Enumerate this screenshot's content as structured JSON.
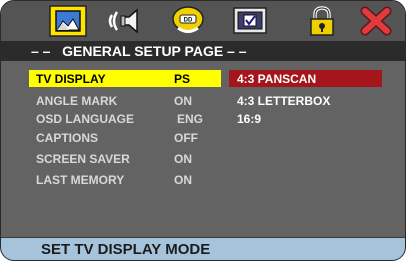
{
  "header": {
    "icons": [
      {
        "name": "general-setup-icon"
      },
      {
        "name": "audio-setup-icon"
      },
      {
        "name": "dolby-disc-icon"
      },
      {
        "name": "preference-checkbox-icon"
      },
      {
        "name": "password-lock-icon"
      },
      {
        "name": "exit-icon"
      }
    ],
    "title": "– –   GENERAL SETUP PAGE – –"
  },
  "menu": {
    "items": [
      {
        "label": "TV DISPLAY",
        "value": "PS"
      },
      {
        "label": "ANGLE MARK",
        "value": "ON"
      },
      {
        "label": "OSD LANGUAGE",
        "value": "ENG"
      },
      {
        "label": "CAPTIONS",
        "value": "OFF"
      },
      {
        "label": "SCREEN SAVER",
        "value": "ON"
      },
      {
        "label": "LAST MEMORY",
        "value": "ON"
      }
    ],
    "options": [
      "4:3 PANSCAN",
      "4:3 LETTERBOX",
      "16:9"
    ]
  },
  "status": {
    "text": "SET TV DISPLAY MODE"
  },
  "colors": {
    "menu_selection": "#ffff00",
    "option_selection": "#a4161b",
    "status_bar": "#a5c4dc",
    "icon_highlight": "#ffff00"
  }
}
